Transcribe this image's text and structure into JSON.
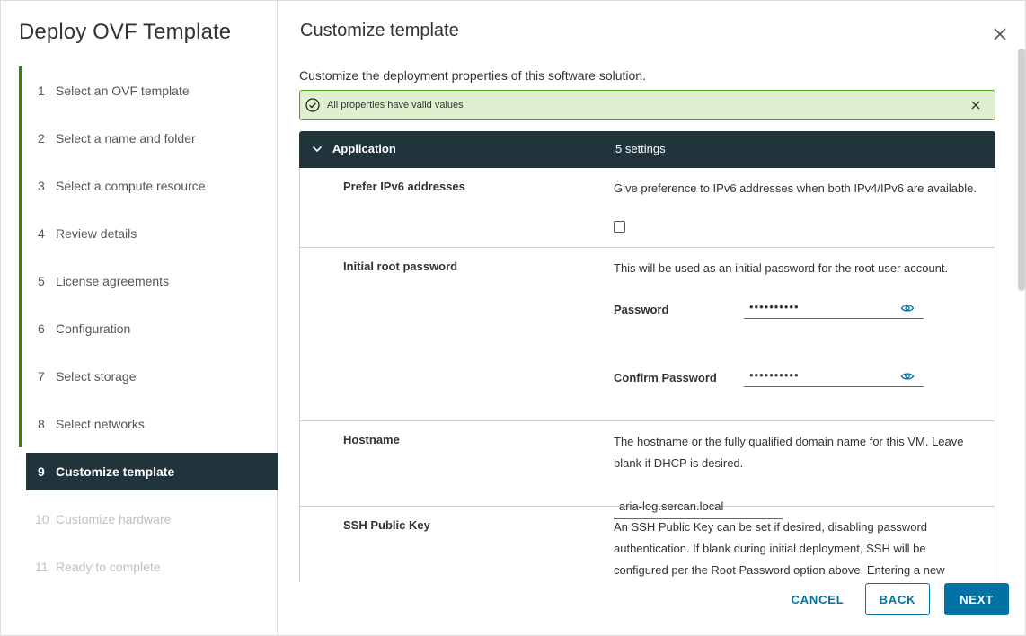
{
  "wizard": {
    "title": "Deploy OVF Template",
    "steps": [
      {
        "num": "1",
        "label": "Select an OVF template"
      },
      {
        "num": "2",
        "label": "Select a name and folder"
      },
      {
        "num": "3",
        "label": "Select a compute resource"
      },
      {
        "num": "4",
        "label": "Review details"
      },
      {
        "num": "5",
        "label": "License agreements"
      },
      {
        "num": "6",
        "label": "Configuration"
      },
      {
        "num": "7",
        "label": "Select storage"
      },
      {
        "num": "8",
        "label": "Select networks"
      },
      {
        "num": "9",
        "label": "Customize template"
      },
      {
        "num": "10",
        "label": "Customize hardware"
      },
      {
        "num": "11",
        "label": "Ready to complete"
      }
    ]
  },
  "page": {
    "title": "Customize template",
    "subtitle": "Customize the deployment properties of this software solution.",
    "alert": "All properties have valid values"
  },
  "group": {
    "name": "Application",
    "count": "5 settings"
  },
  "properties": {
    "ipv6": {
      "label": "Prefer IPv6 addresses",
      "desc": "Give preference to IPv6 addresses when both IPv4/IPv6 are available."
    },
    "root_password": {
      "label": "Initial root password",
      "desc": "This will be used as an initial password for the root user account.",
      "password_label": "Password",
      "password_value": "••••••••••",
      "confirm_label": "Confirm Password",
      "confirm_value": "••••••••••"
    },
    "hostname": {
      "label": "Hostname",
      "desc": "The hostname or the fully qualified domain name for this VM. Leave blank if DHCP is desired.",
      "value": "aria-log.sercan.local"
    },
    "ssh_key": {
      "label": "SSH Public Key",
      "desc": "An SSH Public Key can be set if desired, disabling password authentication. If blank during initial deployment, SSH will be configured per the Root Password option above. Entering a new"
    }
  },
  "footer": {
    "cancel": "CANCEL",
    "back": "BACK",
    "next": "NEXT"
  },
  "colors": {
    "header_dark": "#21333b",
    "accent": "#0072a3",
    "done_bar": "#318700",
    "alert_bg": "#dff0d0",
    "alert_border": "#5aa220"
  }
}
